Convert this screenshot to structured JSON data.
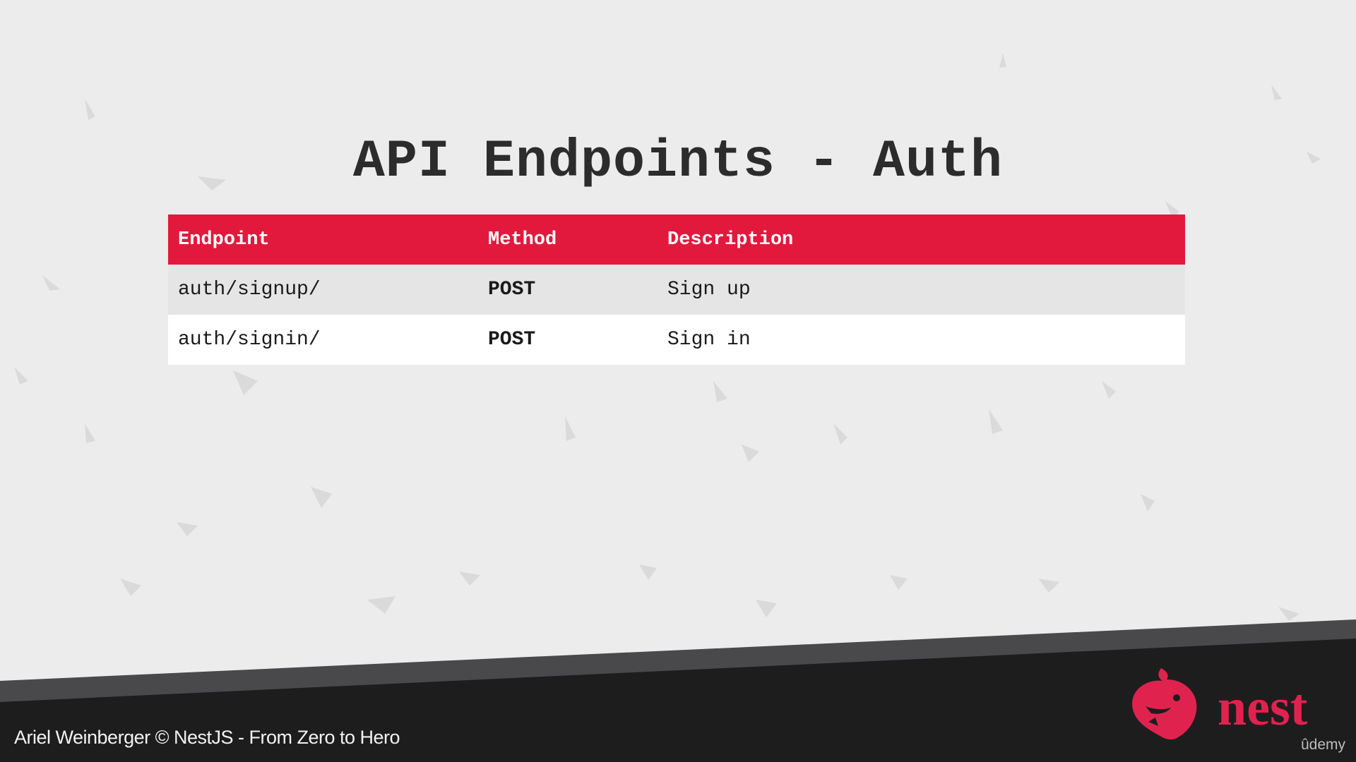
{
  "slide": {
    "title": "API Endpoints - Auth"
  },
  "table": {
    "headers": [
      "Endpoint",
      "Method",
      "Description"
    ],
    "rows": [
      {
        "endpoint": "auth/signup/",
        "method": "POST",
        "description": "Sign up"
      },
      {
        "endpoint": "auth/signin/",
        "method": "POST",
        "description": "Sign in"
      }
    ]
  },
  "footer": {
    "caption": "Ariel Weinberger © NestJS - From Zero to Hero",
    "logo_text": "nest",
    "platform": "ûdemy"
  },
  "colors": {
    "accent": "#e2193d",
    "footer_bg": "#1d1d1e",
    "slide_bg": "#ececec"
  },
  "icons": {
    "logo": "nestjs-cat-logo-icon"
  }
}
